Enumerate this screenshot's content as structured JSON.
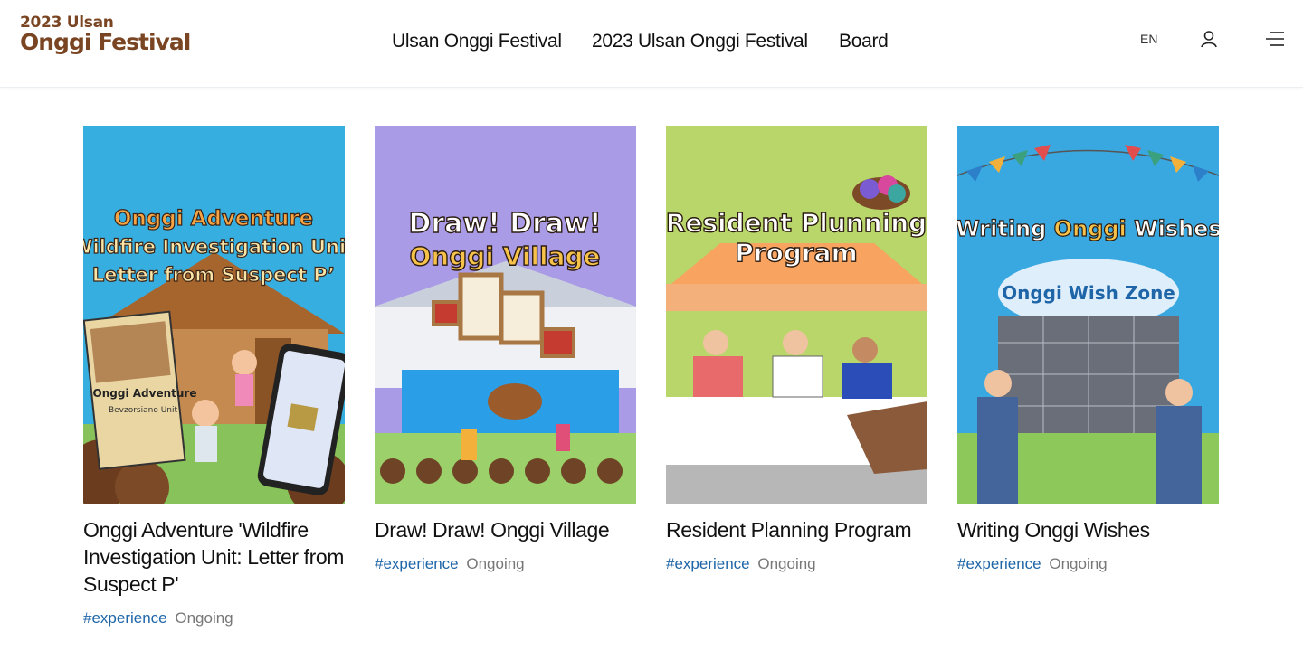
{
  "logo": {
    "line1": "2023 Ulsan",
    "line2": "Onggi Festival"
  },
  "nav": [
    {
      "label": "Ulsan Onggi Festival"
    },
    {
      "label": "2023 Ulsan Onggi Festival"
    },
    {
      "label": "Board"
    }
  ],
  "header_utils": {
    "lang": "EN",
    "user_icon": "user-icon",
    "menu_icon": "hamburger-menu-icon"
  },
  "cards": [
    {
      "title": "Onggi Adventure 'Wildfire Investigation Unit: Letter from Suspect P'",
      "tag": "#experience",
      "status": "Ongoing",
      "poster": {
        "line1": "Onggi Adventure",
        "line2": "‘Wildfire Investigation Unit:",
        "line3": "Letter from Suspect P’",
        "book_label": "Onggi Adventure",
        "book_sub": "Bevzorsiano Unit"
      }
    },
    {
      "title": "Draw! Draw! Onggi Village",
      "tag": "#experience",
      "status": "Ongoing",
      "poster": {
        "line1": "Draw! Draw!",
        "line2": "Onggi Village"
      }
    },
    {
      "title": "Resident Planning Program",
      "tag": "#experience",
      "status": "Ongoing",
      "poster": {
        "line1": "Resident Plunning",
        "line2": "Program"
      }
    },
    {
      "title": "Writing Onggi Wishes",
      "tag": "#experience",
      "status": "Ongoing",
      "poster": {
        "line1a": "Writing ",
        "line1b": "Onggi",
        "line1c": " Wishes",
        "zone": "Onggi Wish Zone"
      }
    }
  ],
  "colors": {
    "brand_brown": "#7a4522",
    "tag_blue": "#1f66a8",
    "status_gray": "#777777",
    "poster1_bg": "#36aee0",
    "poster2_bg": "#a99be6",
    "poster3_bg": "#b8d66a",
    "poster4_bg": "#3aa8e0"
  }
}
